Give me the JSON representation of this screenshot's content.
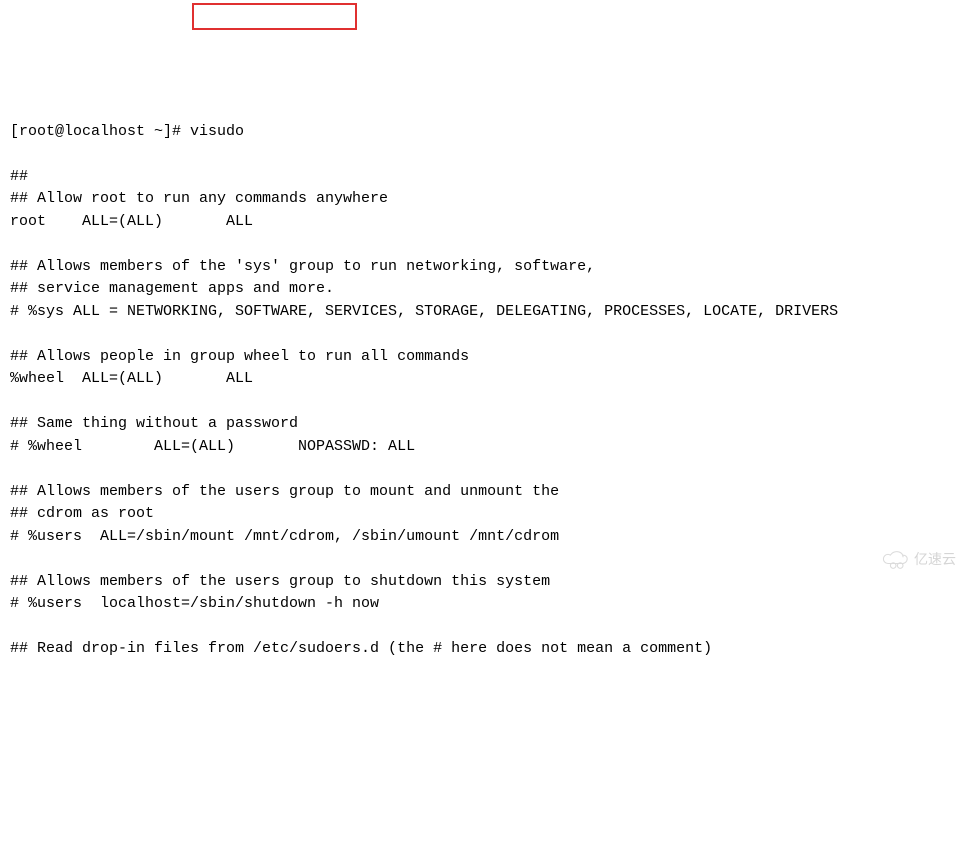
{
  "terminal": {
    "prompt": "[root@localhost ~]# ",
    "command": "visudo",
    "lines": [
      "",
      "##",
      "## Allow root to run any commands anywhere",
      "root    ALL=(ALL)       ALL",
      "",
      "## Allows members of the 'sys' group to run networking, software,",
      "## service management apps and more.",
      "# %sys ALL = NETWORKING, SOFTWARE, SERVICES, STORAGE, DELEGATING, PROCESSES, LOCATE, DRIVERS",
      "",
      "## Allows people in group wheel to run all commands",
      "%wheel  ALL=(ALL)       ALL",
      "",
      "## Same thing without a password",
      "# %wheel        ALL=(ALL)       NOPASSWD: ALL",
      "",
      "## Allows members of the users group to mount and unmount the",
      "## cdrom as root",
      "# %users  ALL=/sbin/mount /mnt/cdrom, /sbin/umount /mnt/cdrom",
      "",
      "## Allows members of the users group to shutdown this system",
      "# %users  localhost=/sbin/shutdown -h now",
      "",
      "## Read drop-in files from /etc/sudoers.d (the # here does not mean a comment)"
    ]
  },
  "watermark": {
    "text": "亿速云"
  }
}
